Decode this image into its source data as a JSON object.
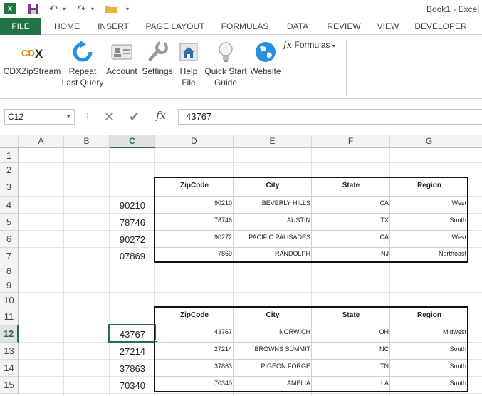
{
  "window": {
    "title": "Book1 - Excel"
  },
  "tabs": [
    "FILE",
    "HOME",
    "INSERT",
    "PAGE LAYOUT",
    "FORMULAS",
    "DATA",
    "REVIEW",
    "VIEW",
    "DEVELOPER"
  ],
  "ribbon": {
    "buttons": [
      {
        "label": "CDXZipStream",
        "icon": "cdx-logo-icon"
      },
      {
        "label": "Repeat Last Query",
        "icon": "repeat-arrow-icon"
      },
      {
        "label": "Account",
        "icon": "account-card-icon"
      },
      {
        "label": "Settings",
        "icon": "wrench-icon"
      },
      {
        "label": "Help File",
        "icon": "help-file-icon"
      },
      {
        "label": "Quick Start Guide",
        "icon": "lightbulb-icon"
      },
      {
        "label": "Website",
        "icon": "globe-icon"
      }
    ],
    "formulas_menu": {
      "icon_text": "fx",
      "label": "Formulas"
    }
  },
  "formula_bar": {
    "name_box": "C12",
    "content": "43767",
    "cancel_icon": "✕",
    "enter_icon": "✔",
    "fx_label": "fx"
  },
  "sheet": {
    "columns": [
      "A",
      "B",
      "C",
      "D",
      "E",
      "F",
      "G"
    ],
    "selected_column": "C",
    "rows": [
      "1",
      "2",
      "3",
      "4",
      "5",
      "6",
      "7",
      "8",
      "9",
      "10",
      "11",
      "12",
      "13",
      "14",
      "15"
    ],
    "selected_row": "12",
    "selected_cell": "C12",
    "column_c_values": {
      "r4": "90210",
      "r5": "78746",
      "r6": "90272",
      "r7": "07869",
      "r12": "43767",
      "r13": "27214",
      "r14": "37863",
      "r15": "70340"
    }
  },
  "table1": {
    "headers": [
      "ZipCode",
      "City",
      "State",
      "Region"
    ],
    "rows": [
      [
        "90210",
        "BEVERLY HILLS",
        "CA",
        "West"
      ],
      [
        "78746",
        "AUSTIN",
        "TX",
        "South"
      ],
      [
        "90272",
        "PACIFIC PALISADES",
        "CA",
        "West"
      ],
      [
        "7869",
        "RANDOLPH",
        "NJ",
        "Northeast"
      ]
    ]
  },
  "table2": {
    "headers": [
      "ZipCode",
      "City",
      "State",
      "Region"
    ],
    "rows": [
      [
        "43767",
        "NORWICH",
        "OH",
        "Midwest"
      ],
      [
        "27214",
        "BROWNS SUMMIT",
        "NC",
        "South"
      ],
      [
        "37863",
        "PIGEON FORGE",
        "TN",
        "South"
      ],
      [
        "70340",
        "AMELIA",
        "LA",
        "South"
      ]
    ]
  },
  "colors": {
    "excel_green": "#217346"
  }
}
